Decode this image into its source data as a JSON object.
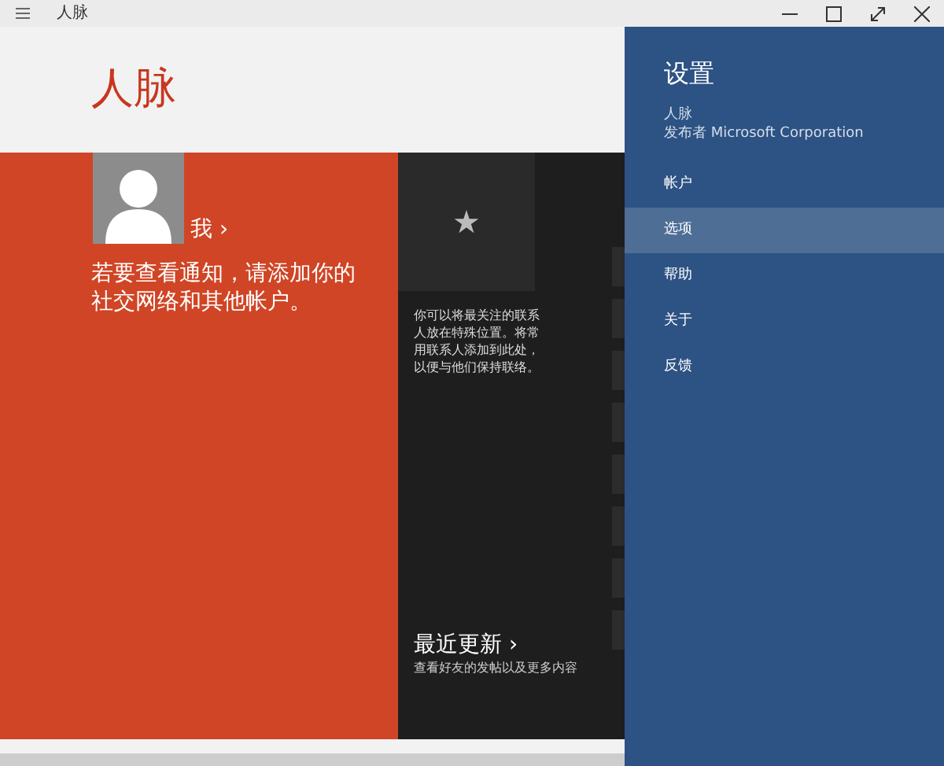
{
  "window": {
    "title": "人脉"
  },
  "page_title": "人脉",
  "me_tile": {
    "label": "我 ›",
    "message": "若要查看通知，请添加你的社交网络和其他帐户。"
  },
  "favorites_tile": {
    "icon": "★",
    "message": "你可以将最关注的联系人放在特殊位置。将常用联系人添加到此处，以便与他们保持联络。"
  },
  "updates": {
    "title": "最近更新 ›",
    "subtitle": "查看好友的发帖以及更多内容"
  },
  "settings": {
    "title": "设置",
    "app": "人脉",
    "publisher": "发布者 Microsoft Corporation",
    "items": [
      {
        "label": "帐户",
        "selected": false
      },
      {
        "label": "选项",
        "selected": true
      },
      {
        "label": "帮助",
        "selected": false
      },
      {
        "label": "关于",
        "selected": false
      },
      {
        "label": "反馈",
        "selected": false
      }
    ]
  }
}
